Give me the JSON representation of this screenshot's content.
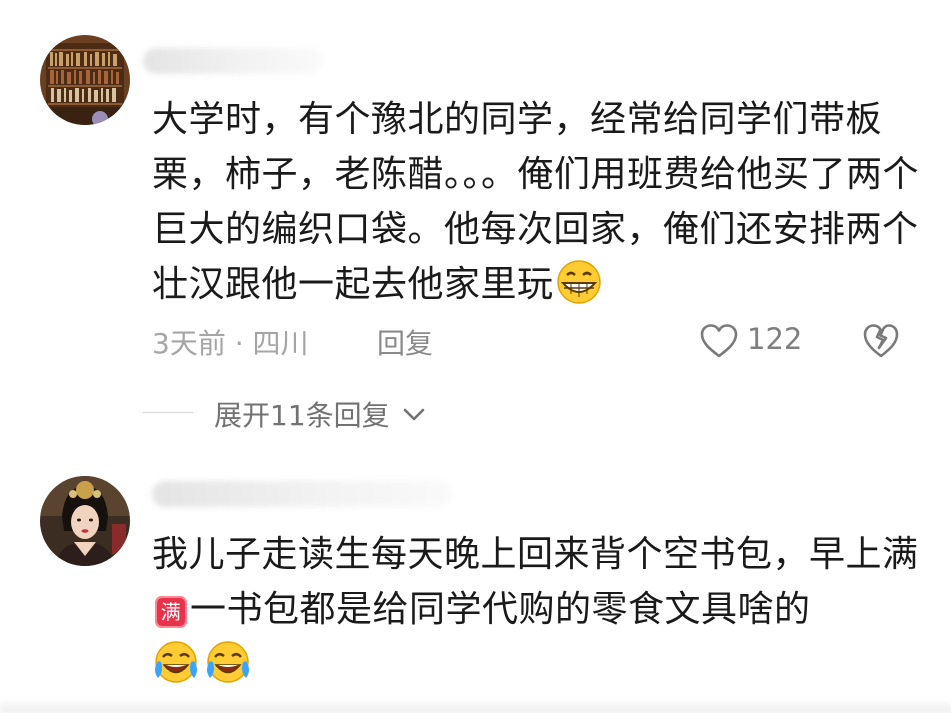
{
  "comments": [
    {
      "text": "大学时，有个豫北的同学，经常给同学们带板栗，柿子，老陈醋。。。俺们用班费给他买了两个巨大的编织口袋。他每次回家，俺们还安排两个壮汉跟他一起去他家里玩",
      "emoji_icon": "grinning-face-emoji",
      "meta": "3天前 · 四川",
      "reply_label": "回复",
      "like_count": "122",
      "expand_label": "展开11条回复"
    },
    {
      "text_part1": "我儿子走读生每天晚上回来背个空书包，早上满",
      "badge_label": "满",
      "text_part2": "一书包都是给同学代购的零食文具啥的",
      "emoji_icons": [
        "tears-of-joy-emoji",
        "tears-of-joy-emoji"
      ]
    }
  ],
  "colors": {
    "text": "#1a1a1a",
    "meta": "#a5a5a5",
    "badge": "#e8344a"
  }
}
